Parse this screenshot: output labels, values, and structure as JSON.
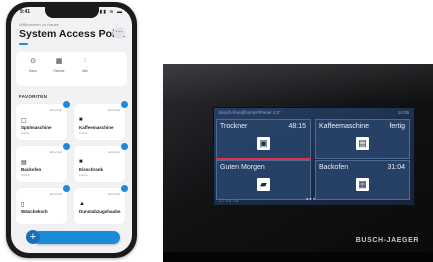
{
  "phone": {
    "status_time": "9:41",
    "status_icons": "▮▮ ≋ ▬",
    "app_subtitle": "Willkommen zu Hause",
    "app_title": "System Access Point",
    "menu_icon_glyph": "⋯",
    "quick_items": [
      {
        "icon": "⊙",
        "label": "Haus"
      },
      {
        "icon": "▦",
        "label": "Räume"
      },
      {
        "icon": "⫶",
        "label": "Alle"
      }
    ],
    "favorites_title": "FAVORITEN",
    "tiles": [
      {
        "toggle": "Einschalt",
        "icon": "▢",
        "name": "Spülmaschine",
        "sub": "Küche"
      },
      {
        "toggle": "Einschalt",
        "icon": "■",
        "name": "Kaffeemaschine",
        "sub": "Küche"
      },
      {
        "toggle": "Einschalt",
        "icon": "▤",
        "name": "Backofen",
        "sub": "Küche"
      },
      {
        "toggle": "Einschalt",
        "icon": "■",
        "name": "Eisschrank",
        "sub": "Küche"
      },
      {
        "toggle": "Einschalt",
        "icon": "▯",
        "name": "Wäschekorb",
        "sub": ""
      },
      {
        "toggle": "Einschalt",
        "icon": "▲",
        "name": "Dunstabzugshaube",
        "sub": ""
      }
    ],
    "fab_glyph": "+"
  },
  "panel": {
    "header_left": "Busch-free@home®Panel 4.3\"",
    "header_right": "14:05",
    "tiles": [
      {
        "name": "Trockner",
        "value": "48:15",
        "icon": "▣"
      },
      {
        "name": "Kaffeemaschine",
        "value": "fertig",
        "icon": "▤"
      },
      {
        "name": "Guten Morgen",
        "value": "",
        "icon": "▰"
      },
      {
        "name": "Backofen",
        "value": "31:04",
        "icon": "▦"
      }
    ],
    "footer_left": "17.03.18",
    "page_dots": "●●●",
    "brand": "BUSCH-JAEGER"
  },
  "colors": {
    "accent": "#1a8bd6",
    "panel_tile": "#284268",
    "panel_red": "#d9304c"
  }
}
